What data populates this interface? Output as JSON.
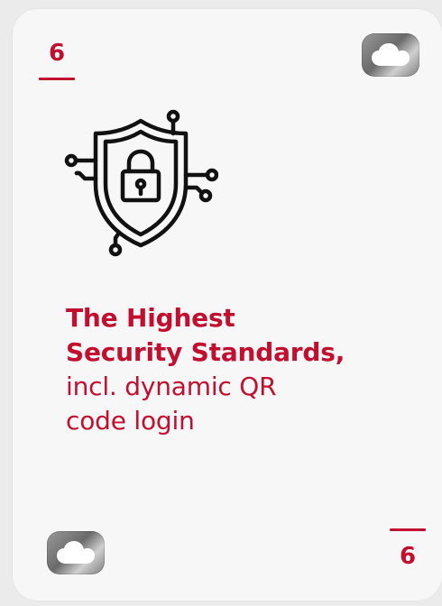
{
  "card": {
    "number_top": "6",
    "number_bottom": "6",
    "title_line1": "The Highest",
    "title_line2": "Security Standards,",
    "subtitle_line1": "incl. dynamic QR",
    "subtitle_line2": "code login"
  },
  "icons": {
    "badge": "cloud-icon",
    "main": "security-shield-lock-icon"
  },
  "colors": {
    "accent": "#c20f2f",
    "card_background": "#f7f7f7",
    "icon_stroke": "#111111"
  }
}
